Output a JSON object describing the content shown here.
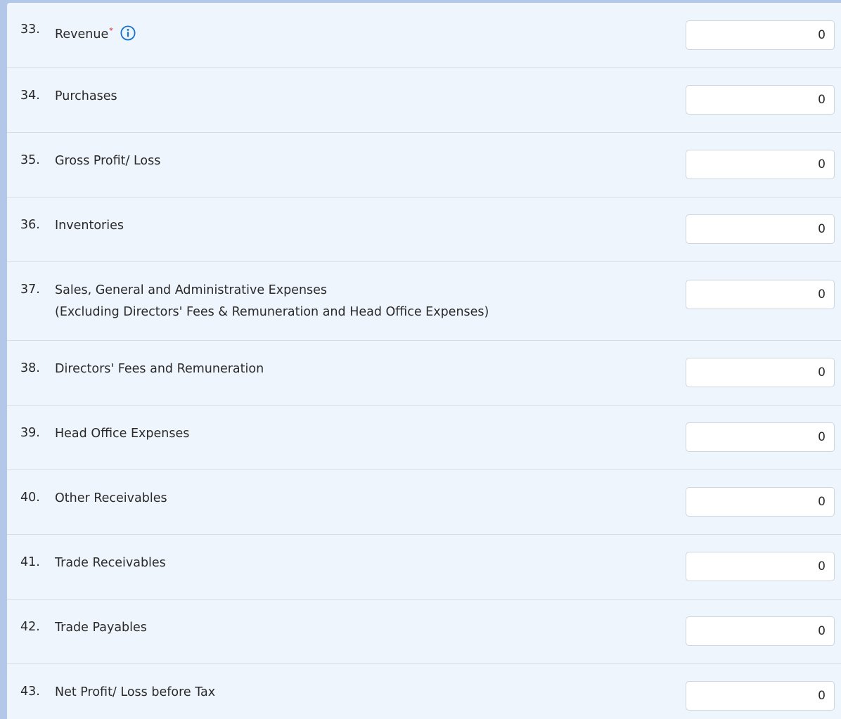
{
  "form": {
    "rows": [
      {
        "number": "33.",
        "label": "Revenue",
        "required": true,
        "info": true,
        "value": "0"
      },
      {
        "number": "34.",
        "label": "Purchases",
        "value": "0"
      },
      {
        "number": "35.",
        "label": "Gross Profit/ Loss",
        "value": "0"
      },
      {
        "number": "36.",
        "label": "Inventories",
        "value": "0"
      },
      {
        "number": "37.",
        "label": "Sales, General and Administrative Expenses",
        "sublabel": "(Excluding Directors' Fees & Remuneration and Head Office Expenses)",
        "value": "0"
      },
      {
        "number": "38.",
        "label": "Directors' Fees and Remuneration",
        "value": "0"
      },
      {
        "number": "39.",
        "label": "Head Office Expenses",
        "value": "0"
      },
      {
        "number": "40.",
        "label": "Other Receivables",
        "value": "0"
      },
      {
        "number": "41.",
        "label": "Trade Receivables",
        "value": "0"
      },
      {
        "number": "42.",
        "label": "Trade Payables",
        "value": "0"
      },
      {
        "number": "43.",
        "label": "Net Profit/ Loss before Tax",
        "value": "0"
      }
    ],
    "required_marker": "*",
    "info_icon": "info-circle-icon",
    "colors": {
      "panel_background": "#eef5fd",
      "frame_background": "#b3c8e8",
      "required": "#d62020",
      "info_icon": "#1a73c8"
    }
  }
}
